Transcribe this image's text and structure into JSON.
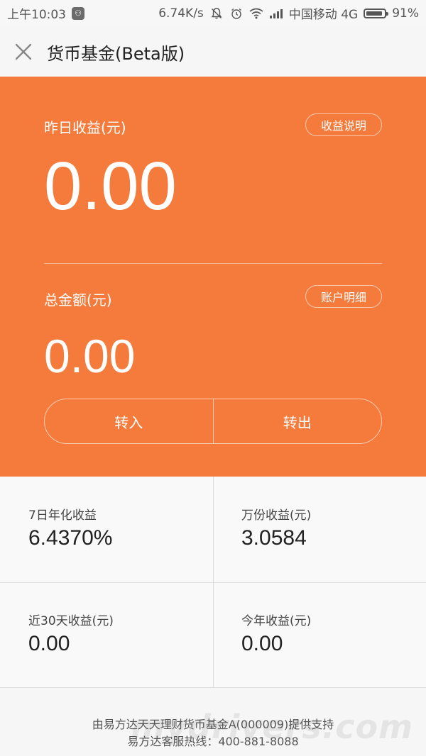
{
  "status_bar": {
    "time": "上午10:03",
    "speed": "6.74K/s",
    "carrier": "中国移动 4G",
    "battery": "91%",
    "battery_level": 0.91,
    "icons": [
      "app-icon",
      "bell-off-icon",
      "alarm-icon",
      "wifi-icon",
      "signal-icon",
      "battery-icon"
    ]
  },
  "header": {
    "title": "货币基金(Beta版)",
    "close_icon": "close-icon"
  },
  "summary": {
    "yesterday_label": "昨日收益(元)",
    "yesterday_info_button": "收益说明",
    "yesterday_value": "0.00",
    "total_label": "总金额(元)",
    "account_details_button": "账户明细",
    "total_value": "0.00",
    "transfer_in": "转入",
    "transfer_out": "转出",
    "accent_color": "#f47b3b"
  },
  "stats": [
    {
      "label": "7日年化收益",
      "value": "6.4370%"
    },
    {
      "label": "万份收益(元)",
      "value": "3.0584"
    },
    {
      "label": "近30天收益(元)",
      "value": "0.00"
    },
    {
      "label": "今年收益(元)",
      "value": "0.00"
    }
  ],
  "footer": {
    "line1": "由易方达天天理财货币基金A(000009)提供支持",
    "line2": "易方达客服热线：400-881-8088",
    "watermark": "mydrivers.com"
  }
}
